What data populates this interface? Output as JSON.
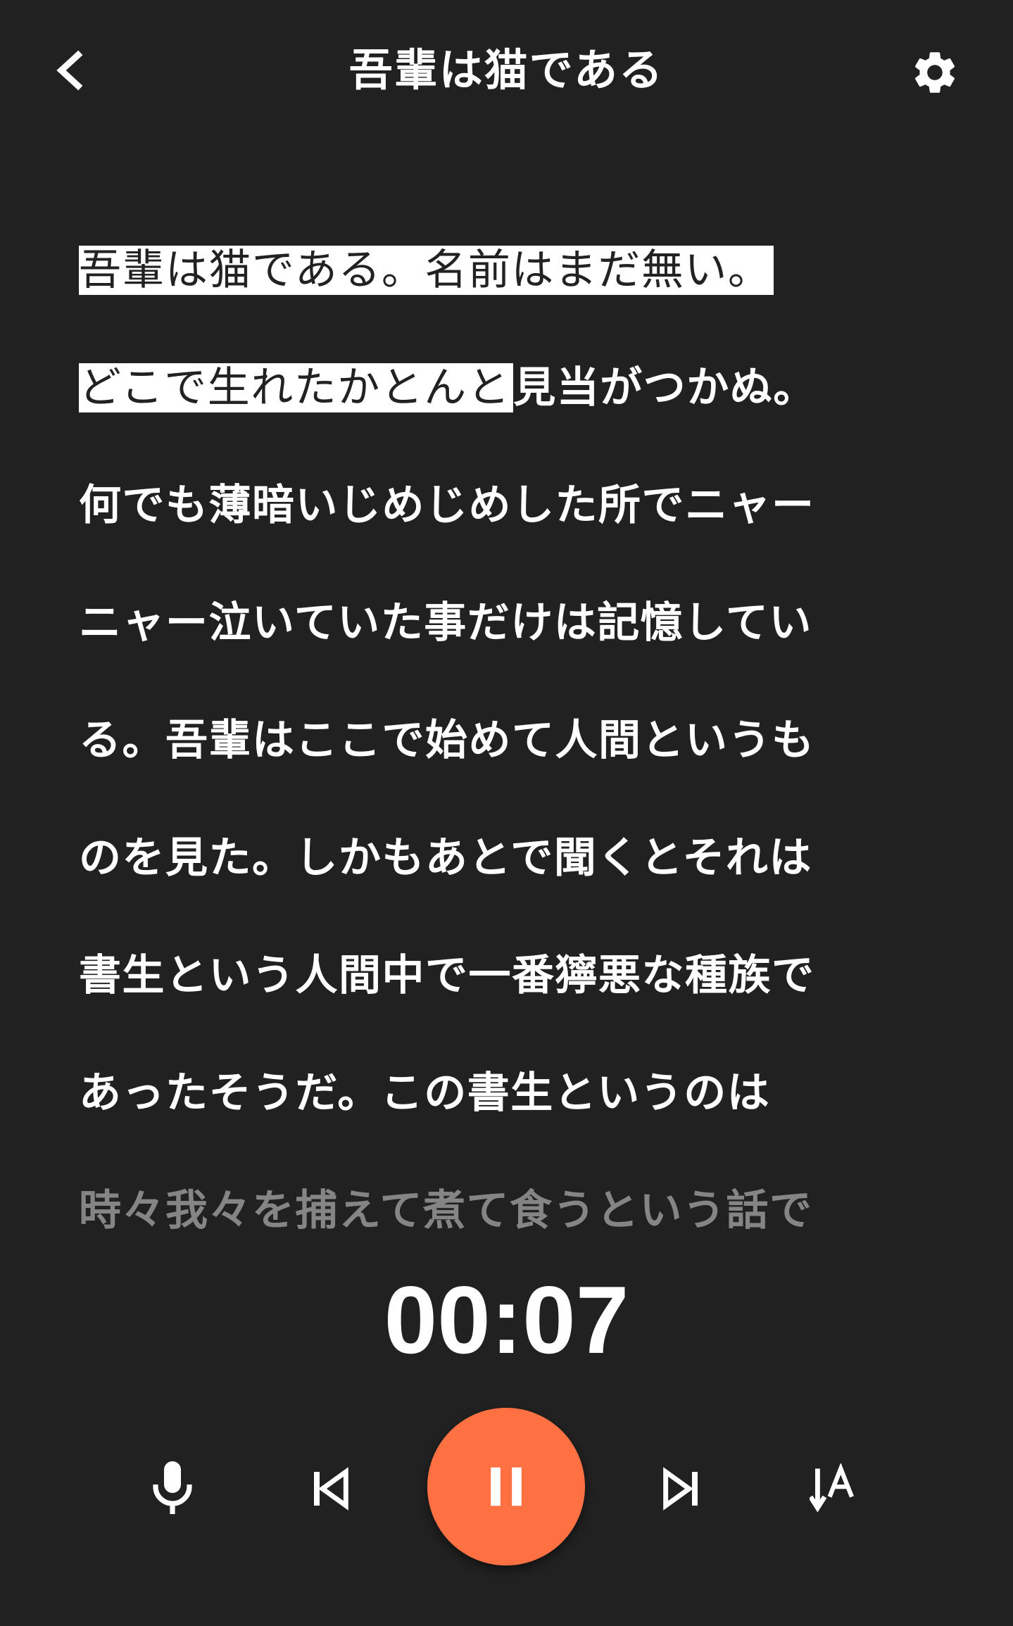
{
  "header": {
    "title": "吾輩は猫である",
    "back_icon": "chevron-left-icon",
    "settings_icon": "gear-icon"
  },
  "reader": {
    "lines": [
      {
        "highlight": "吾輩は猫である。名前はまだ無い。",
        "rest": ""
      },
      {
        "highlight": "どこで生れたかとんと",
        "rest": "見当がつかぬ。"
      },
      {
        "highlight": "",
        "rest": "何でも薄暗いじめじめした所でニャー"
      },
      {
        "highlight": "",
        "rest": "ニャー泣いていた事だけは記憶してい"
      },
      {
        "highlight": "",
        "rest": "る。吾輩はここで始めて人間というも"
      },
      {
        "highlight": "",
        "rest": "のを見た。しかもあとで聞くとそれは"
      },
      {
        "highlight": "",
        "rest": "書生という人間中で一番獰悪な種族で"
      },
      {
        "highlight": "",
        "rest": "あったそうだ。この書生というのは"
      },
      {
        "highlight": "",
        "rest": "時々我々を捕えて煮て食うという話で"
      }
    ],
    "highlight_color": "#ffffff"
  },
  "player": {
    "elapsed": "00:07",
    "accent_color": "#ff7043",
    "icons": {
      "mic": "mic-icon",
      "prev": "skip-previous-icon",
      "pause": "pause-icon",
      "next": "skip-next-icon",
      "font": "font-size-icon"
    }
  }
}
